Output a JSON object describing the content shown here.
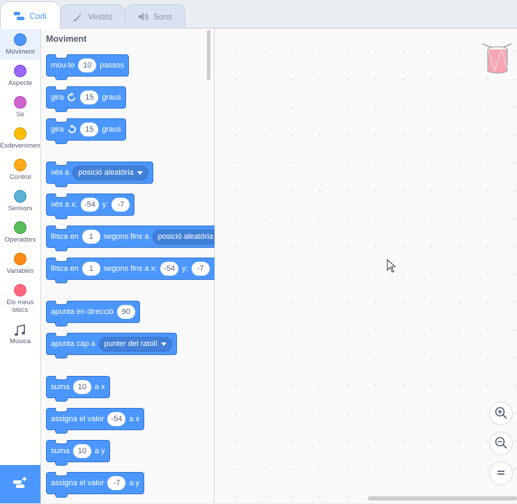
{
  "tabs": [
    {
      "label": "Codi",
      "icon": "code-icon",
      "active": true
    },
    {
      "label": "Vestits",
      "icon": "brush-icon",
      "active": false
    },
    {
      "label": "Sons",
      "icon": "speaker-icon",
      "active": false
    }
  ],
  "categories": [
    {
      "label": "Moviment",
      "color": "#4c97ff",
      "border": "#3373cc",
      "selected": true
    },
    {
      "label": "Aspecte",
      "color": "#9966ff",
      "border": "#774dcb"
    },
    {
      "label": "So",
      "color": "#cf63cf",
      "border": "#bd42bd"
    },
    {
      "label": "Esdeveniments",
      "color": "#ffbf00",
      "border": "#cc9900"
    },
    {
      "label": "Control",
      "color": "#ffab19",
      "border": "#cf8b17"
    },
    {
      "label": "Sensors",
      "color": "#5cb1d6",
      "border": "#2e8eb8"
    },
    {
      "label": "Operadors",
      "color": "#59c059",
      "border": "#389438"
    },
    {
      "label": "Variables",
      "color": "#ff8c1a",
      "border": "#db6e00"
    },
    {
      "label": "Els meus blocs",
      "color": "#ff6680",
      "border": "#ff4d6a"
    },
    {
      "label": "Música",
      "icon": "music-notes-icon"
    }
  ],
  "flyout": {
    "title": "Moviment",
    "blocks": {
      "move": {
        "t1": "mou-te",
        "v1": "10",
        "t2": "passos"
      },
      "turn_right": {
        "t1": "gira",
        "v1": "15",
        "t2": "graus"
      },
      "turn_left": {
        "t1": "gira",
        "v1": "15",
        "t2": "graus"
      },
      "goto": {
        "t1": "vés a",
        "menu": "posició aleatòria"
      },
      "goto_xy": {
        "t1": "vés a x:",
        "v1": "-54",
        "t2": "y:",
        "v2": "-7"
      },
      "glide": {
        "t1": "llisca en",
        "v1": "1",
        "t2": "segons fins a",
        "menu": "posició aleatòria"
      },
      "glide_xy": {
        "t1": "llisca en",
        "v1": "1",
        "t2": "segons fins a x:",
        "v2": "-54",
        "t3": "y:",
        "v3": "-7"
      },
      "point_dir": {
        "t1": "apunta en direcció",
        "v1": "90"
      },
      "point_towards": {
        "t1": "apunta cap a",
        "menu": "punter del ratolí"
      },
      "change_x": {
        "t1": "suma",
        "v1": "10",
        "t2": "a x"
      },
      "set_x": {
        "t1": "assigna el valor",
        "v1": "-54",
        "t2": "a x"
      },
      "change_y": {
        "t1": "suma",
        "v1": "10",
        "t2": "a y"
      },
      "set_y": {
        "t1": "assigna el valor",
        "v1": "-7",
        "t2": "a y"
      }
    }
  },
  "zoom_controls": [
    "zoom-in-icon",
    "zoom-out-icon",
    "zoom-reset-icon"
  ],
  "sprite_thumb": "drum-sprite-icon",
  "extension_button": "add-extension-icon"
}
